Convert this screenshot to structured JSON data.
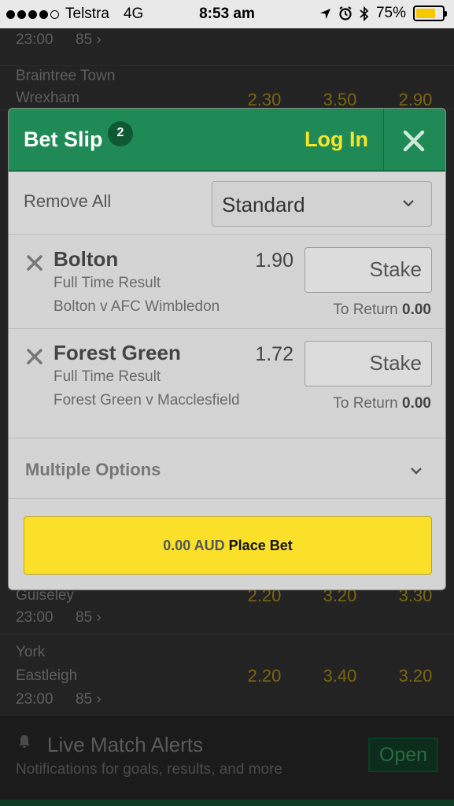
{
  "status_bar": {
    "carrier": "Telstra",
    "network": "4G",
    "time": "8:53 am",
    "battery_percent": "75%",
    "battery_level": 0.75,
    "signal_bars": 4
  },
  "background": {
    "rows": [
      {
        "time": "23:00",
        "markets": "85 ›"
      },
      {
        "home": "Braintree Town",
        "away": "Wrexham",
        "odds": [
          "2.30",
          "3.50",
          "2.90"
        ]
      },
      {
        "home": "Guiseley",
        "time": "23:00",
        "markets": "85 ›",
        "odds": [
          "2.20",
          "3.20",
          "3.30"
        ]
      },
      {
        "home": "York",
        "away": "Eastleigh",
        "time": "23:00",
        "markets": "85 ›",
        "odds": [
          "2.20",
          "3.40",
          "3.20"
        ]
      }
    ],
    "alerts": {
      "title": "Live Match Alerts",
      "subtitle": "Notifications for goals, results, and more",
      "button": "Open"
    }
  },
  "bet_slip": {
    "title": "Bet Slip",
    "badge": "2",
    "login_label": "Log In",
    "remove_all_label": "Remove All",
    "bet_type": "Standard",
    "selections": [
      {
        "name": "Bolton",
        "market": "Full Time Result",
        "event": "Bolton v AFC Wimbledon",
        "odds": "1.90",
        "stake_placeholder": "Stake",
        "to_return_label": "To Return",
        "to_return_value": "0.00"
      },
      {
        "name": "Forest Green",
        "market": "Full Time Result",
        "event": "Forest Green v Macclesfield",
        "odds": "1.72",
        "stake_placeholder": "Stake",
        "to_return_label": "To Return",
        "to_return_value": "0.00"
      }
    ],
    "multiple_options_label": "Multiple Options",
    "place_bet": {
      "amount": "0.00 AUD",
      "label": "Place Bet"
    }
  },
  "colors": {
    "header_green": "#1f8a55",
    "accent_yellow": "#fbe02a",
    "login_yellow": "#f7e32a"
  }
}
